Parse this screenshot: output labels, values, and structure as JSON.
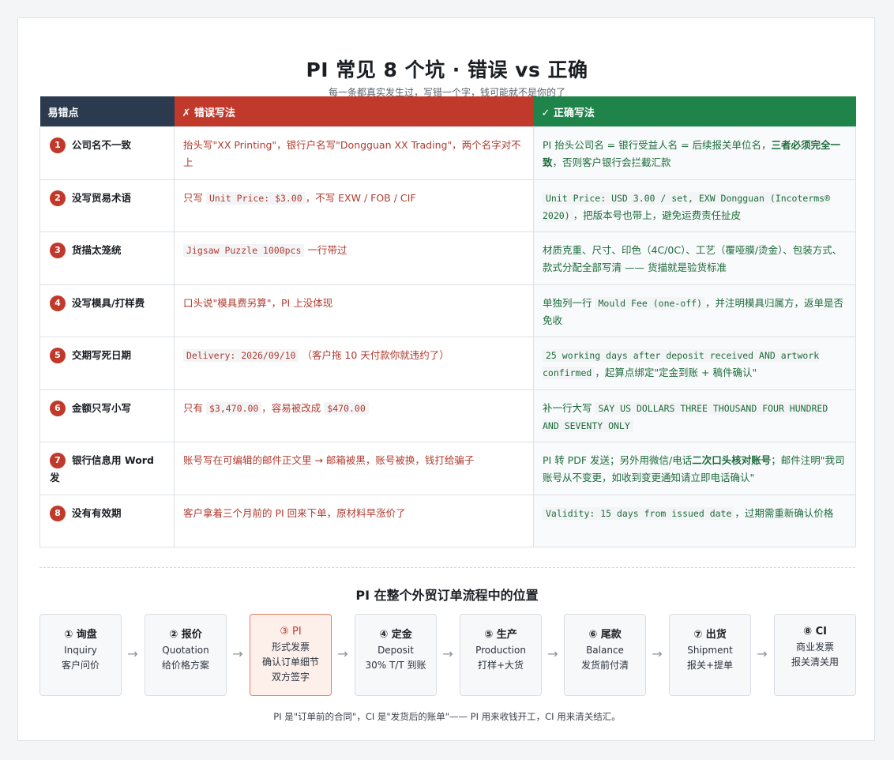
{
  "title": "PI 常见 8 个坑 · 错误 vs 正确",
  "subtitle": "每一条都真实发生过，写错一个字，钱可能就不是你的了",
  "table": {
    "headers": {
      "point": "易错点",
      "wrong": "✗ 错误写法",
      "right": "✓ 正确写法"
    },
    "rows": [
      {
        "n": "1",
        "point": "公司名不一致",
        "wrong": [
          "抬头写\"XX Printing\"，银行户名写\"Dongguan XX Trading\"，两个名字对不上"
        ],
        "right": [
          "PI 抬头公司名 = 银行受益人名 = 后续报关单位名，",
          "三者必须完全一致",
          "，否则客户银行会拦截汇款"
        ]
      },
      {
        "n": "2",
        "point": "没写贸易术语",
        "wrong": [
          "只写 ",
          "Unit Price: $3.00",
          "，不写 EXW / FOB / CIF"
        ],
        "right": [
          "Unit Price: USD 3.00 / set, EXW Dongguan (Incoterms® 2020)",
          "，把版本号也带上，避免运费责任扯皮"
        ]
      },
      {
        "n": "3",
        "point": "货描太笼统",
        "wrong": [
          "Jigsaw Puzzle 1000pcs",
          " 一行带过"
        ],
        "right": [
          "材质克重、尺寸、印色（4C/0C）、工艺（覆哑膜/烫金）、包装方式、款式分配全部写清 —— 货描就是验货标准"
        ]
      },
      {
        "n": "4",
        "point": "没写模具/打样费",
        "wrong": [
          "口头说\"模具费另算\"，PI 上没体现"
        ],
        "right": [
          "单独列一行 ",
          "Mould Fee (one-off)",
          "，并注明模具归属方，返单是否免收"
        ]
      },
      {
        "n": "5",
        "point": "交期写死日期",
        "wrong": [
          "Delivery: 2026/09/10",
          " （客户拖 10 天付款你就违约了）"
        ],
        "right": [
          "25 working days after deposit received AND artwork confirmed",
          "，起算点绑定\"定金到账 + 稿件确认\""
        ]
      },
      {
        "n": "6",
        "point": "金额只写小写",
        "wrong": [
          "只有 ",
          "$3,470.00",
          "，容易被改成 ",
          "$470.00"
        ],
        "right": [
          "补一行大写 ",
          "SAY US DOLLARS THREE THOUSAND FOUR HUNDRED AND SEVENTY ONLY"
        ]
      },
      {
        "n": "7",
        "point": "银行信息用 Word 发",
        "wrong": [
          "账号写在可编辑的邮件正文里 → 邮箱被黑，账号被换，钱打给骗子"
        ],
        "right": [
          "PI 转 PDF 发送；另外用微信/电话",
          "二次口头核对账号",
          "；邮件注明\"我司账号从不变更，如收到变更通知请立即电话确认\""
        ]
      },
      {
        "n": "8",
        "point": "没有有效期",
        "wrong": [
          "客户拿着三个月前的 PI 回来下单，原材料早涨价了"
        ],
        "right": [
          "Validity: 15 days from issued date",
          "，过期需重新确认价格"
        ]
      }
    ]
  },
  "flow": {
    "title": "PI 在整个外贸订单流程中的位置",
    "steps": [
      {
        "title": "① 询盘",
        "line1": "Inquiry",
        "line2": "客户问价",
        "line3": ""
      },
      {
        "title": "② 报价",
        "line1": "Quotation",
        "line2": "给价格方案",
        "line3": ""
      },
      {
        "title": "③ PI",
        "line1": "形式发票",
        "line2": "确认订单细节",
        "line3": "双方签字"
      },
      {
        "title": "④ 定金",
        "line1": "Deposit",
        "line2": "30% T/T 到账",
        "line3": ""
      },
      {
        "title": "⑤ 生产",
        "line1": "Production",
        "line2": "打样+大货",
        "line3": ""
      },
      {
        "title": "⑥ 尾款",
        "line1": "Balance",
        "line2": "发货前付清",
        "line3": ""
      },
      {
        "title": "⑦ 出货",
        "line1": "Shipment",
        "line2": "报关+提单",
        "line3": ""
      },
      {
        "title": "⑧ CI",
        "line1": "商业发票",
        "line2": "报关清关用",
        "line3": ""
      }
    ],
    "arrow": "→",
    "footnote": "PI 是\"订单前的合同\"，CI 是\"发货后的账单\"—— PI 用来收钱开工，CI 用来清关结汇。"
  },
  "colors": {
    "header_point": "#2b3a4e",
    "header_wrong": "#c0392b",
    "header_right": "#1e8449",
    "wrong_text": "#b03a2e",
    "right_text": "#1e6b3c",
    "badge": "#c0392b",
    "active_step_bg": "#fdf0eb"
  }
}
